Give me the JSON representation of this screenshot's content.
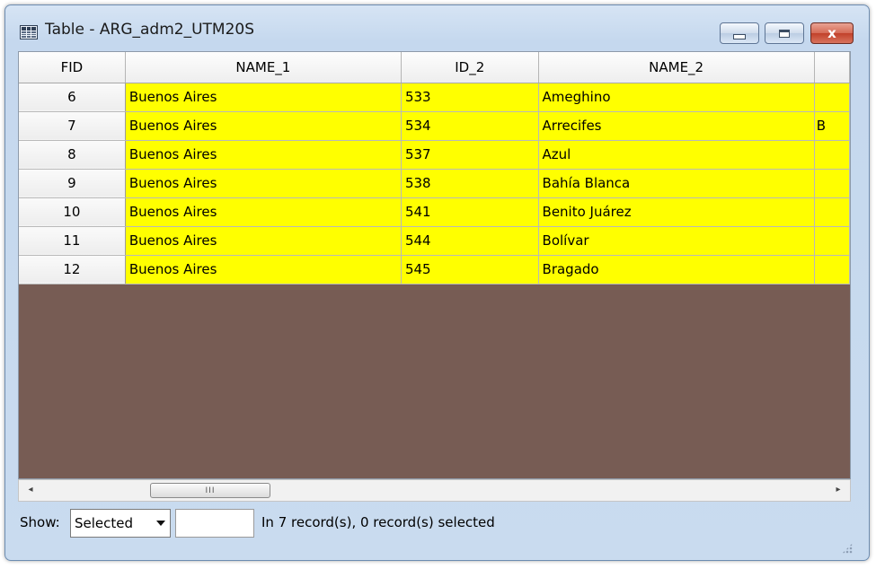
{
  "window": {
    "title": "Table - ARG_adm2_UTM20S",
    "icon": "table-icon",
    "controls": {
      "minimize": "minimize-icon",
      "maximize": "maximize-icon",
      "close": "close-icon",
      "close_glyph": "x"
    }
  },
  "table": {
    "columns": [
      "FID",
      "NAME_1",
      "ID_2",
      "NAME_2"
    ],
    "partial_column_visible_text": "B",
    "rows": [
      {
        "fid": "6",
        "name_1": "Buenos Aires",
        "id_2": "533",
        "name_2": "Ameghino",
        "extra": ""
      },
      {
        "fid": "7",
        "name_1": "Buenos Aires",
        "id_2": "534",
        "name_2": "Arrecifes",
        "extra": "B"
      },
      {
        "fid": "8",
        "name_1": "Buenos Aires",
        "id_2": "537",
        "name_2": "Azul",
        "extra": ""
      },
      {
        "fid": "9",
        "name_1": "Buenos Aires",
        "id_2": "538",
        "name_2": "Bahía Blanca",
        "extra": ""
      },
      {
        "fid": "10",
        "name_1": "Buenos Aires",
        "id_2": "541",
        "name_2": "Benito Juárez",
        "extra": ""
      },
      {
        "fid": "11",
        "name_1": "Buenos Aires",
        "id_2": "544",
        "name_2": "Bolívar",
        "extra": ""
      },
      {
        "fid": "12",
        "name_1": "Buenos Aires",
        "id_2": "545",
        "name_2": "Bragado",
        "extra": ""
      }
    ],
    "highlight_color": "#ffff00",
    "empty_area_color": "#775c54"
  },
  "scrollbar": {
    "left_arrow": "◂",
    "right_arrow": "▸",
    "thumb_grip": "III"
  },
  "status": {
    "show_label": "Show:",
    "show_selected": "Selected",
    "record_text": "In 7 record(s), 0 record(s) selected"
  }
}
